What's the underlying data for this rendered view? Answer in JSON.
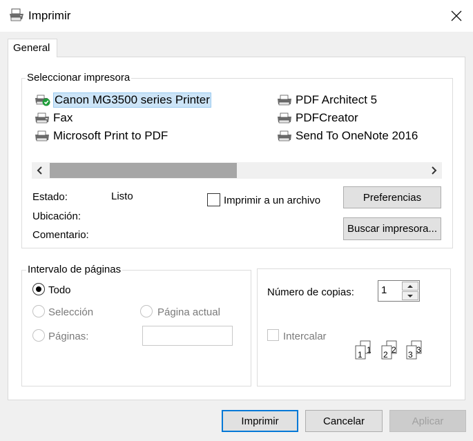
{
  "window": {
    "title": "Imprimir"
  },
  "tabs": [
    {
      "label": "General"
    }
  ],
  "printer_group": {
    "label": "Seleccionar impresora",
    "printers": [
      {
        "name": "Canon MG3500 series Printer",
        "selected": true,
        "icon": "printer-default-icon"
      },
      {
        "name": "Fax",
        "icon": "fax-icon"
      },
      {
        "name": "Microsoft Print to PDF",
        "icon": "printer-icon"
      },
      {
        "name": "PDF Architect 5",
        "icon": "printer-icon"
      },
      {
        "name": "PDFCreator",
        "icon": "printer-icon"
      },
      {
        "name": "Send To OneNote 2016",
        "icon": "printer-icon"
      }
    ],
    "status_label": "Estado:",
    "status_value": "Listo",
    "location_label": "Ubicación:",
    "comment_label": "Comentario:",
    "print_to_file": {
      "label": "Imprimir a un archivo",
      "checked": false
    },
    "preferences_label": "Preferencias",
    "find_printer_label": "Buscar impresora..."
  },
  "page_range": {
    "label": "Intervalo de páginas",
    "options": {
      "all": {
        "label": "Todo",
        "selected": true
      },
      "selection": {
        "label": "Selección",
        "enabled": false
      },
      "current_page": {
        "label": "Página actual",
        "enabled": false
      },
      "pages": {
        "label": "Páginas:",
        "enabled": false,
        "value": ""
      }
    }
  },
  "copies": {
    "label": "Número de copias:",
    "value": "1",
    "collate": {
      "label": "Intercalar",
      "checked": false,
      "enabled": false
    },
    "collate_digits": [
      "1",
      "1",
      "2",
      "2",
      "3",
      "3"
    ]
  },
  "footer": {
    "print_label": "Imprimir",
    "cancel_label": "Cancelar",
    "apply_label": "Aplicar"
  },
  "colors": {
    "selection_bg": "#cce4f7",
    "default_button_border": "#0078d7",
    "status_check": "#1f9d3a"
  }
}
